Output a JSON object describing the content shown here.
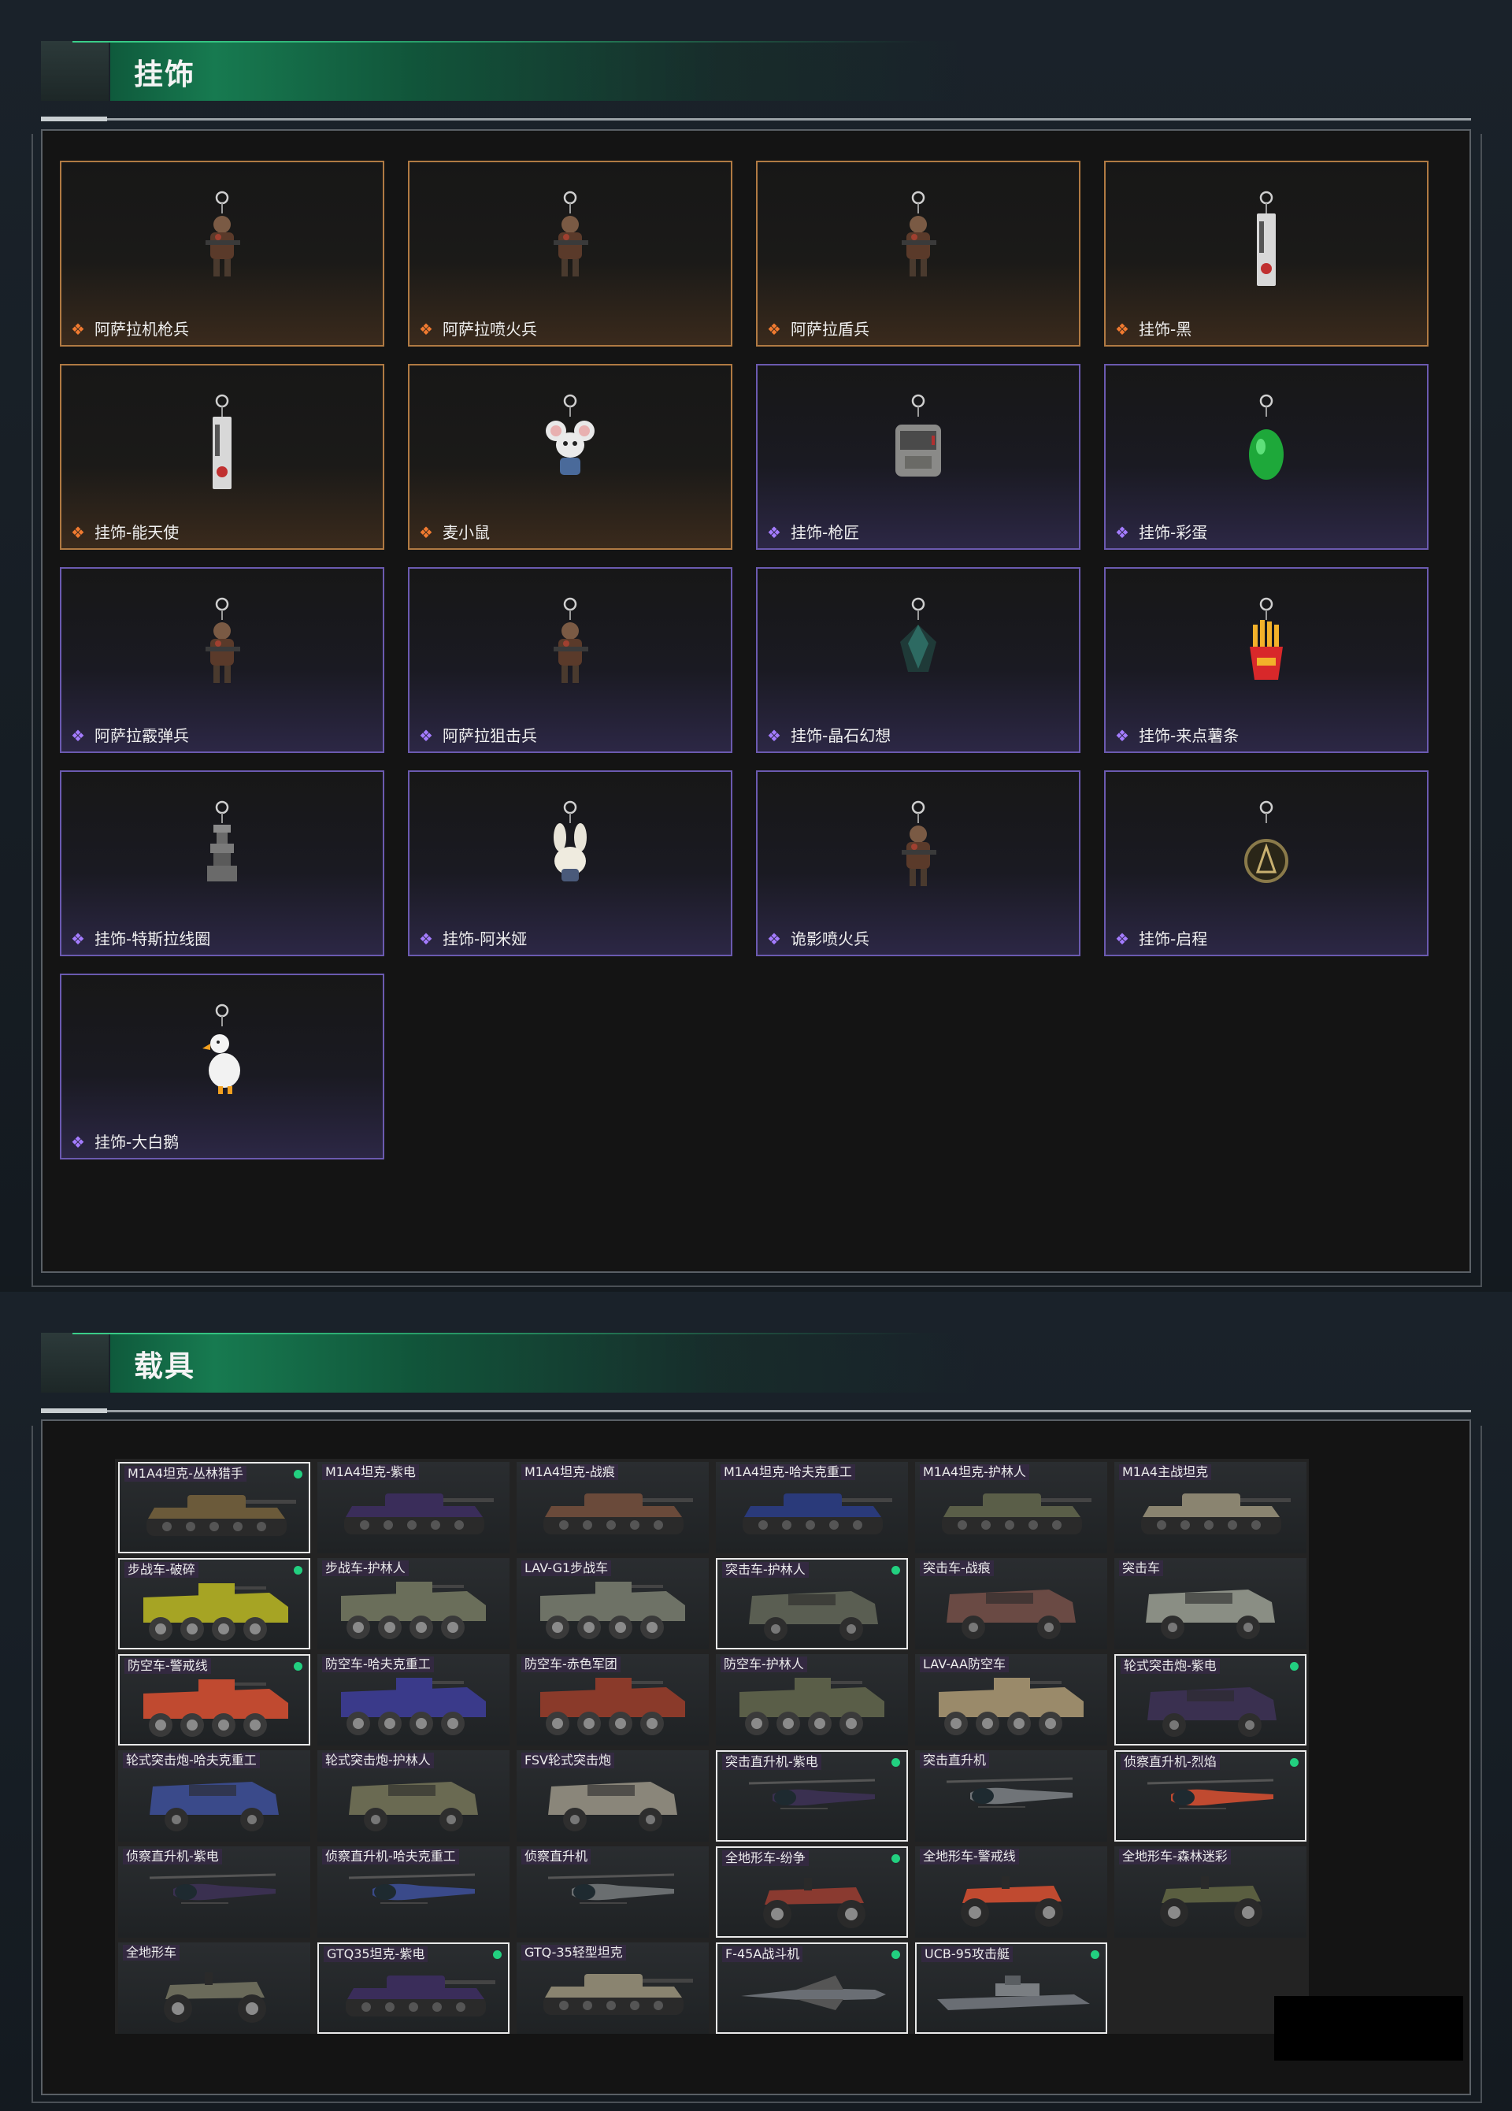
{
  "colors": {
    "accent_green": "#22d080",
    "gold_rarity": "#f07a30",
    "purple_rarity": "#a47cff"
  },
  "charms_section": {
    "title": "挂饰",
    "items": [
      {
        "label": "阿萨拉机枪兵",
        "rarity": "gold",
        "icon": "soldier-charm-icon"
      },
      {
        "label": "阿萨拉喷火兵",
        "rarity": "gold",
        "icon": "soldier-charm-icon"
      },
      {
        "label": "阿萨拉盾兵",
        "rarity": "gold",
        "icon": "soldier-charm-icon"
      },
      {
        "label": "挂饰-黑",
        "rarity": "gold",
        "icon": "tag-charm-icon"
      },
      {
        "label": "挂饰-能天使",
        "rarity": "gold",
        "icon": "tag-charm-icon"
      },
      {
        "label": "麦小鼠",
        "rarity": "gold",
        "icon": "mouse-charm-icon"
      },
      {
        "label": "挂饰-枪匠",
        "rarity": "purple",
        "icon": "case-charm-icon"
      },
      {
        "label": "挂饰-彩蛋",
        "rarity": "purple",
        "icon": "egg-charm-icon"
      },
      {
        "label": "阿萨拉霰弹兵",
        "rarity": "purple",
        "icon": "soldier-charm-icon"
      },
      {
        "label": "阿萨拉狙击兵",
        "rarity": "purple",
        "icon": "soldier-charm-icon"
      },
      {
        "label": "挂饰-晶石幻想",
        "rarity": "purple",
        "icon": "crystal-charm-icon"
      },
      {
        "label": "挂饰-来点薯条",
        "rarity": "purple",
        "icon": "fries-charm-icon"
      },
      {
        "label": "挂饰-特斯拉线圈",
        "rarity": "purple",
        "icon": "coil-charm-icon"
      },
      {
        "label": "挂饰-阿米娅",
        "rarity": "purple",
        "icon": "bunny-charm-icon"
      },
      {
        "label": "诡影喷火兵",
        "rarity": "purple",
        "icon": "soldier-charm-icon"
      },
      {
        "label": "挂饰-启程",
        "rarity": "purple",
        "icon": "medal-charm-icon"
      },
      {
        "label": "挂饰-大白鹅",
        "rarity": "purple",
        "icon": "goose-charm-icon"
      }
    ]
  },
  "vehicles_section": {
    "title": "载具",
    "items": [
      {
        "label": "M1A4坦克-丛林猎手",
        "selected": true,
        "type": "tank",
        "camo": "#6b5a3a"
      },
      {
        "label": "M1A4坦克-紫电",
        "selected": false,
        "type": "tank",
        "camo": "#3a2d5a"
      },
      {
        "label": "M1A4坦克-战痕",
        "selected": false,
        "type": "tank",
        "camo": "#6a4a3a"
      },
      {
        "label": "M1A4坦克-哈夫克重工",
        "selected": false,
        "type": "tank",
        "camo": "#2a3a7a"
      },
      {
        "label": "M1A4坦克-护林人",
        "selected": false,
        "type": "tank",
        "camo": "#5a5e48"
      },
      {
        "label": "M1A4主战坦克",
        "selected": false,
        "type": "tank",
        "camo": "#8a8470"
      },
      {
        "label": "步战车-破碎",
        "selected": true,
        "type": "ifv",
        "camo": "#a6a424"
      },
      {
        "label": "步战车-护林人",
        "selected": false,
        "type": "ifv",
        "camo": "#6a6e5a"
      },
      {
        "label": "LAV-G1步战车",
        "selected": false,
        "type": "ifv",
        "camo": "#6e7266"
      },
      {
        "label": "突击车-护林人",
        "selected": true,
        "type": "truck",
        "camo": "#5a5e52"
      },
      {
        "label": "突击车-战痕",
        "selected": false,
        "type": "truck",
        "camo": "#6a4a44"
      },
      {
        "label": "突击车",
        "selected": false,
        "type": "truck",
        "camo": "#8a8e84"
      },
      {
        "label": "防空车-警戒线",
        "selected": true,
        "type": "ifv",
        "camo": "#c04a30"
      },
      {
        "label": "防空车-哈夫克重工",
        "selected": false,
        "type": "ifv",
        "camo": "#3a3a8a"
      },
      {
        "label": "防空车-赤色军团",
        "selected": false,
        "type": "ifv",
        "camo": "#8a3a2a"
      },
      {
        "label": "防空车-护林人",
        "selected": false,
        "type": "ifv",
        "camo": "#5a5e48"
      },
      {
        "label": "LAV-AA防空车",
        "selected": false,
        "type": "ifv",
        "camo": "#9a8a6a"
      },
      {
        "label": "轮式突击炮-紫电",
        "selected": true,
        "type": "truck",
        "camo": "#3a3050"
      },
      {
        "label": "轮式突击炮-哈夫克重工",
        "selected": false,
        "type": "truck",
        "camo": "#3a4a8a"
      },
      {
        "label": "轮式突击炮-护林人",
        "selected": false,
        "type": "truck",
        "camo": "#6a6a52"
      },
      {
        "label": "FSV轮式突击炮",
        "selected": false,
        "type": "truck",
        "camo": "#8a867a"
      },
      {
        "label": "突击直升机-紫电",
        "selected": true,
        "type": "heli",
        "camo": "#3a3050"
      },
      {
        "label": "突击直升机",
        "selected": false,
        "type": "heli",
        "camo": "#707478"
      },
      {
        "label": "侦察直升机-烈焰",
        "selected": true,
        "type": "heli",
        "camo": "#c04a30"
      },
      {
        "label": "侦察直升机-紫电",
        "selected": false,
        "type": "heli",
        "camo": "#3a3050"
      },
      {
        "label": "侦察直升机-哈夫克重工",
        "selected": false,
        "type": "heli",
        "camo": "#3a4a8a"
      },
      {
        "label": "侦察直升机",
        "selected": false,
        "type": "heli",
        "camo": "#6a6e70"
      },
      {
        "label": "全地形车-纷争",
        "selected": true,
        "type": "atv",
        "camo": "#8a3a30"
      },
      {
        "label": "全地形车-警戒线",
        "selected": false,
        "type": "atv",
        "camo": "#c04a30"
      },
      {
        "label": "全地形车-森林迷彩",
        "selected": false,
        "type": "atv",
        "camo": "#5a5e40"
      },
      {
        "label": "全地形车",
        "selected": false,
        "type": "atv",
        "camo": "#6a6a5a"
      },
      {
        "label": "GTQ35坦克-紫电",
        "selected": true,
        "type": "tank",
        "camo": "#3a2d5a"
      },
      {
        "label": "GTQ-35轻型坦克",
        "selected": false,
        "type": "tank",
        "camo": "#8a8470"
      },
      {
        "label": "F-45A战斗机",
        "selected": true,
        "type": "jet",
        "camo": "#6a6e74"
      },
      {
        "label": "UCB-95攻击艇",
        "selected": true,
        "type": "boat",
        "camo": "#6a6e74"
      }
    ]
  }
}
